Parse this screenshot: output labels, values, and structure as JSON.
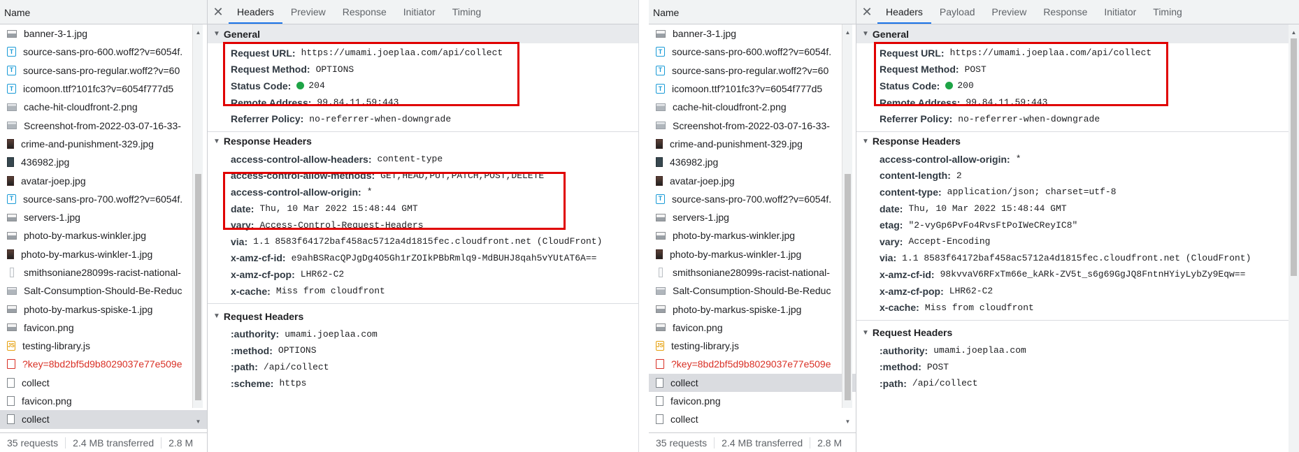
{
  "colors": {
    "highlight": "#e00000",
    "status_ok": "#1ea446",
    "error_text": "#d93025",
    "tab_accent": "#1a73e8"
  },
  "left": {
    "list": {
      "header": "Name",
      "rows": [
        {
          "name": "banner-3-1.jpg",
          "icon": "image-file-icon"
        },
        {
          "name": "source-sans-pro-600.woff2?v=6054f.",
          "icon": "font-file-icon"
        },
        {
          "name": "source-sans-pro-regular.woff2?v=60",
          "icon": "font-file-icon"
        },
        {
          "name": "icomoon.ttf?101fc3?v=6054f777d5",
          "icon": "font-file-icon"
        },
        {
          "name": "cache-hit-cloudfront-2.png",
          "icon": "image-file-icon"
        },
        {
          "name": "Screenshot-from-2022-03-07-16-33-",
          "icon": "image-file-icon"
        },
        {
          "name": "crime-and-punishment-329.jpg",
          "icon": "image-file-icon"
        },
        {
          "name": "436982.jpg",
          "icon": "image-file-icon"
        },
        {
          "name": "avatar-joep.jpg",
          "icon": "image-file-icon"
        },
        {
          "name": "source-sans-pro-700.woff2?v=6054f.",
          "icon": "font-file-icon"
        },
        {
          "name": "servers-1.jpg",
          "icon": "image-file-icon"
        },
        {
          "name": "photo-by-markus-winkler.jpg",
          "icon": "image-file-icon"
        },
        {
          "name": "photo-by-markus-winkler-1.jpg",
          "icon": "image-file-icon"
        },
        {
          "name": "smithsoniane28099s-racist-national-",
          "icon": "image-file-icon"
        },
        {
          "name": "Salt-Consumption-Should-Be-Reduc",
          "icon": "image-file-icon"
        },
        {
          "name": "photo-by-markus-spiske-1.jpg",
          "icon": "image-file-icon"
        },
        {
          "name": "favicon.png",
          "icon": "image-file-icon"
        },
        {
          "name": "testing-library.js",
          "icon": "script-file-icon"
        },
        {
          "name": "?key=8bd2bf5d9b8029037e77e509e",
          "icon": "error-file-icon"
        },
        {
          "name": "collect",
          "icon": "document-file-icon"
        },
        {
          "name": "favicon.png",
          "icon": "document-file-icon"
        },
        {
          "name": "collect",
          "icon": "document-file-icon"
        }
      ]
    },
    "status": {
      "requests": "35 requests",
      "transferred": "2.4 MB transferred",
      "resources": "2.8 M"
    },
    "detail": {
      "tabs": [
        "Headers",
        "Preview",
        "Response",
        "Initiator",
        "Timing"
      ],
      "general": {
        "title": "General",
        "rows": [
          {
            "k": "Request URL:",
            "v": "https://umami.joeplaa.com/api/collect"
          },
          {
            "k": "Request Method:",
            "v": "OPTIONS"
          },
          {
            "k": "Status Code:",
            "v": "204"
          },
          {
            "k": "Remote Address:",
            "v": "99.84.11.59:443"
          },
          {
            "k": "Referrer Policy:",
            "v": "no-referrer-when-downgrade"
          }
        ]
      },
      "response": {
        "title": "Response Headers",
        "rows": [
          {
            "k": "access-control-allow-headers:",
            "v": "content-type"
          },
          {
            "k": "access-control-allow-methods:",
            "v": "GET,HEAD,PUT,PATCH,POST,DELETE"
          },
          {
            "k": "access-control-allow-origin:",
            "v": "*"
          },
          {
            "k": "date:",
            "v": "Thu, 10 Mar 2022 15:48:44 GMT"
          },
          {
            "k": "vary:",
            "v": "Access-Control-Request-Headers"
          },
          {
            "k": "via:",
            "v": "1.1 8583f64172baf458ac5712a4d1815fec.cloudfront.net (CloudFront)"
          },
          {
            "k": "x-amz-cf-id:",
            "v": "e9ahBSRacQPJgDg4O5Gh1rZOIkPBbRmlq9-MdBUHJ8qah5vYUtAT6A=="
          },
          {
            "k": "x-amz-cf-pop:",
            "v": "LHR62-C2"
          },
          {
            "k": "x-cache:",
            "v": "Miss from cloudfront"
          }
        ]
      },
      "request": {
        "title": "Request Headers",
        "rows": [
          {
            "k": ":authority:",
            "v": "umami.joeplaa.com"
          },
          {
            "k": ":method:",
            "v": "OPTIONS"
          },
          {
            "k": ":path:",
            "v": "/api/collect"
          },
          {
            "k": ":scheme:",
            "v": "https"
          }
        ]
      }
    }
  },
  "right": {
    "list": {
      "header": "Name",
      "rows": [
        {
          "name": "banner-3-1.jpg",
          "icon": "image-file-icon"
        },
        {
          "name": "source-sans-pro-600.woff2?v=6054f.",
          "icon": "font-file-icon"
        },
        {
          "name": "source-sans-pro-regular.woff2?v=60",
          "icon": "font-file-icon"
        },
        {
          "name": "icomoon.ttf?101fc3?v=6054f777d5",
          "icon": "font-file-icon"
        },
        {
          "name": "cache-hit-cloudfront-2.png",
          "icon": "image-file-icon"
        },
        {
          "name": "Screenshot-from-2022-03-07-16-33-",
          "icon": "image-file-icon"
        },
        {
          "name": "crime-and-punishment-329.jpg",
          "icon": "image-file-icon"
        },
        {
          "name": "436982.jpg",
          "icon": "image-file-icon"
        },
        {
          "name": "avatar-joep.jpg",
          "icon": "image-file-icon"
        },
        {
          "name": "source-sans-pro-700.woff2?v=6054f.",
          "icon": "font-file-icon"
        },
        {
          "name": "servers-1.jpg",
          "icon": "image-file-icon"
        },
        {
          "name": "photo-by-markus-winkler.jpg",
          "icon": "image-file-icon"
        },
        {
          "name": "photo-by-markus-winkler-1.jpg",
          "icon": "image-file-icon"
        },
        {
          "name": "smithsoniane28099s-racist-national-",
          "icon": "image-file-icon"
        },
        {
          "name": "Salt-Consumption-Should-Be-Reduc",
          "icon": "image-file-icon"
        },
        {
          "name": "photo-by-markus-spiske-1.jpg",
          "icon": "image-file-icon"
        },
        {
          "name": "favicon.png",
          "icon": "image-file-icon"
        },
        {
          "name": "testing-library.js",
          "icon": "script-file-icon"
        },
        {
          "name": "?key=8bd2bf5d9b8029037e77e509e",
          "icon": "error-file-icon"
        },
        {
          "name": "collect",
          "icon": "document-file-icon"
        },
        {
          "name": "favicon.png",
          "icon": "document-file-icon"
        },
        {
          "name": "collect",
          "icon": "document-file-icon"
        }
      ]
    },
    "status": {
      "requests": "35 requests",
      "transferred": "2.4 MB transferred",
      "resources": "2.8 M"
    },
    "detail": {
      "tabs": [
        "Headers",
        "Payload",
        "Preview",
        "Response",
        "Initiator",
        "Timing"
      ],
      "general": {
        "title": "General",
        "rows": [
          {
            "k": "Request URL:",
            "v": "https://umami.joeplaa.com/api/collect"
          },
          {
            "k": "Request Method:",
            "v": "POST"
          },
          {
            "k": "Status Code:",
            "v": "200"
          },
          {
            "k": "Remote Address:",
            "v": "99.84.11.59:443"
          },
          {
            "k": "Referrer Policy:",
            "v": "no-referrer-when-downgrade"
          }
        ]
      },
      "response": {
        "title": "Response Headers",
        "rows": [
          {
            "k": "access-control-allow-origin:",
            "v": "*"
          },
          {
            "k": "content-length:",
            "v": "2"
          },
          {
            "k": "content-type:",
            "v": "application/json; charset=utf-8"
          },
          {
            "k": "date:",
            "v": "Thu, 10 Mar 2022 15:48:44 GMT"
          },
          {
            "k": "etag:",
            "v": "\"2-vyGp6PvFo4RvsFtPoIWeCReyIC8\""
          },
          {
            "k": "vary:",
            "v": "Accept-Encoding"
          },
          {
            "k": "via:",
            "v": "1.1 8583f64172baf458ac5712a4d1815fec.cloudfront.net (CloudFront)"
          },
          {
            "k": "x-amz-cf-id:",
            "v": "98kvvaV6RFxTm66e_kARk-ZV5t_s6g69GgJQ8FntnHYiyLybZy9Eqw=="
          },
          {
            "k": "x-amz-cf-pop:",
            "v": "LHR62-C2"
          },
          {
            "k": "x-cache:",
            "v": "Miss from cloudfront"
          }
        ]
      },
      "request": {
        "title": "Request Headers",
        "rows": [
          {
            "k": ":authority:",
            "v": "umami.joeplaa.com"
          },
          {
            "k": ":method:",
            "v": "POST"
          },
          {
            "k": ":path:",
            "v": "/api/collect"
          }
        ]
      }
    }
  }
}
